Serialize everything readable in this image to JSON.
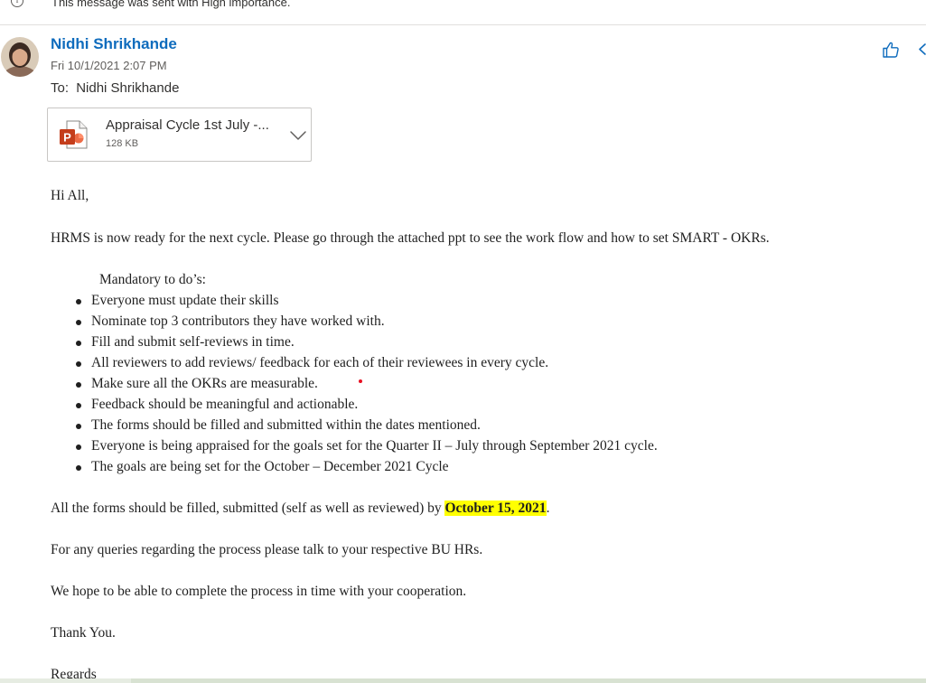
{
  "banner": {
    "icon": "info-icon",
    "text": "This message was sent with High importance."
  },
  "header": {
    "sender_name": "Nidhi Shrikhande",
    "date": "Fri 10/1/2021 2:07 PM",
    "to_label": "To:",
    "to_name": "Nidhi Shrikhande",
    "actions": [
      "like-icon",
      "reply-icon"
    ]
  },
  "attachment": {
    "name": "Appraisal Cycle 1st July -...",
    "size": "128 KB",
    "icon": "powerpoint-icon"
  },
  "body": {
    "greeting": "Hi All,",
    "intro": "HRMS is now ready for the next cycle. Please go through the attached ppt to see the work flow and how to set SMART - OKRs.",
    "mandatory_heading": "Mandatory to do’s:",
    "todo_items": [
      "Everyone must update their skills",
      "Nominate top 3 contributors they have worked with.",
      "Fill and submit self-reviews in time.",
      "All reviewers to add reviews/ feedback for each of their reviewees in every cycle.",
      "Make sure all the OKRs are measurable.",
      "Feedback should be meaningful and actionable.",
      "The forms should be filled and submitted within the dates mentioned.",
      "Everyone is being appraised for the goals set for the Quarter II – July through September 2021 cycle.",
      "The goals are being set for the October – December 2021 Cycle"
    ],
    "deadline_prefix": "All the forms should be filled, submitted (self as well as reviewed) by ",
    "deadline_date": "October 15, 2021",
    "deadline_suffix": ".",
    "queries": "For any queries regarding the process please talk to your respective BU HRs.",
    "hope": "We hope to be able to complete the process in time with your cooperation.",
    "thanks": "Thank You.",
    "regards": "Regards"
  },
  "colors": {
    "sender_link": "#0f6cbd",
    "highlight": "#ffff00",
    "ppt_brand": "#c43e1c"
  }
}
